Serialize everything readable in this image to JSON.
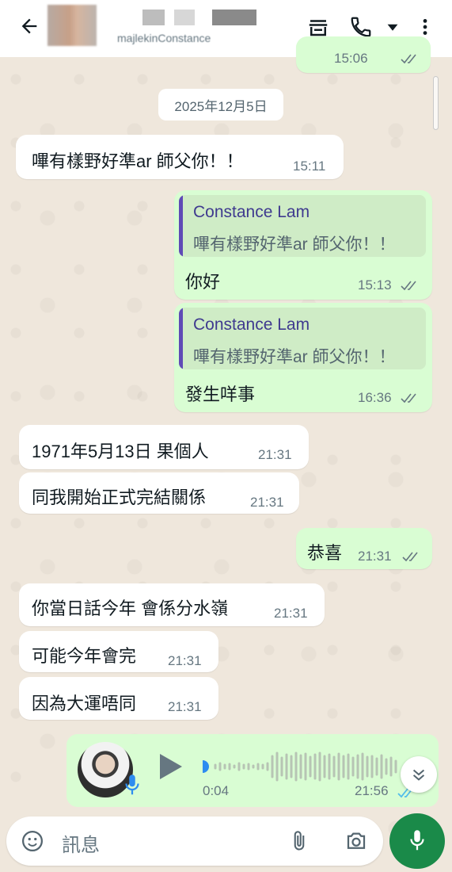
{
  "header": {
    "subtitle": "majlekinConstance",
    "icons": [
      "back-arrow-icon",
      "storefront-icon",
      "phone-icon",
      "dropdown-icon",
      "more-vert-icon"
    ]
  },
  "colors": {
    "chat_bg": "#efe7dc",
    "incoming_bubble": "#ffffff",
    "outgoing_bubble": "#d9fdd3",
    "quote_bar": "#5f4bb6",
    "read_tick": "#53bdeb",
    "mic_button": "#1a8a49"
  },
  "top_partial": {
    "time": "15:06"
  },
  "date_chip": "2025年12月5日",
  "messages": [
    {
      "dir": "in",
      "text": "嗶有樣野好準ar 師父你！！",
      "time": "15:11"
    },
    {
      "dir": "out",
      "quote_name": "Constance Lam",
      "quote_text": "嗶有樣野好準ar 師父你！！",
      "text": "你好",
      "time": "15:13"
    },
    {
      "dir": "out",
      "quote_name": "Constance Lam",
      "quote_text": "嗶有樣野好準ar 師父你！！",
      "text": "發生咩事",
      "time": "16:36"
    },
    {
      "dir": "in",
      "text": "1971年5月13日 果個人",
      "time": "21:31"
    },
    {
      "dir": "in",
      "text": "同我開始正式完結關係",
      "time": "21:31"
    },
    {
      "dir": "out",
      "text": "恭喜",
      "time": "21:31"
    },
    {
      "dir": "in",
      "text": "你當日話今年 會係分水嶺",
      "time": "21:31"
    },
    {
      "dir": "in",
      "text": "可能今年會完",
      "time": "21:31"
    },
    {
      "dir": "in",
      "text": "因為大運唔同",
      "time": "21:31"
    }
  ],
  "voice": {
    "duration": "0:04",
    "time": "21:56",
    "progress": 0
  },
  "input": {
    "placeholder": "訊息"
  }
}
